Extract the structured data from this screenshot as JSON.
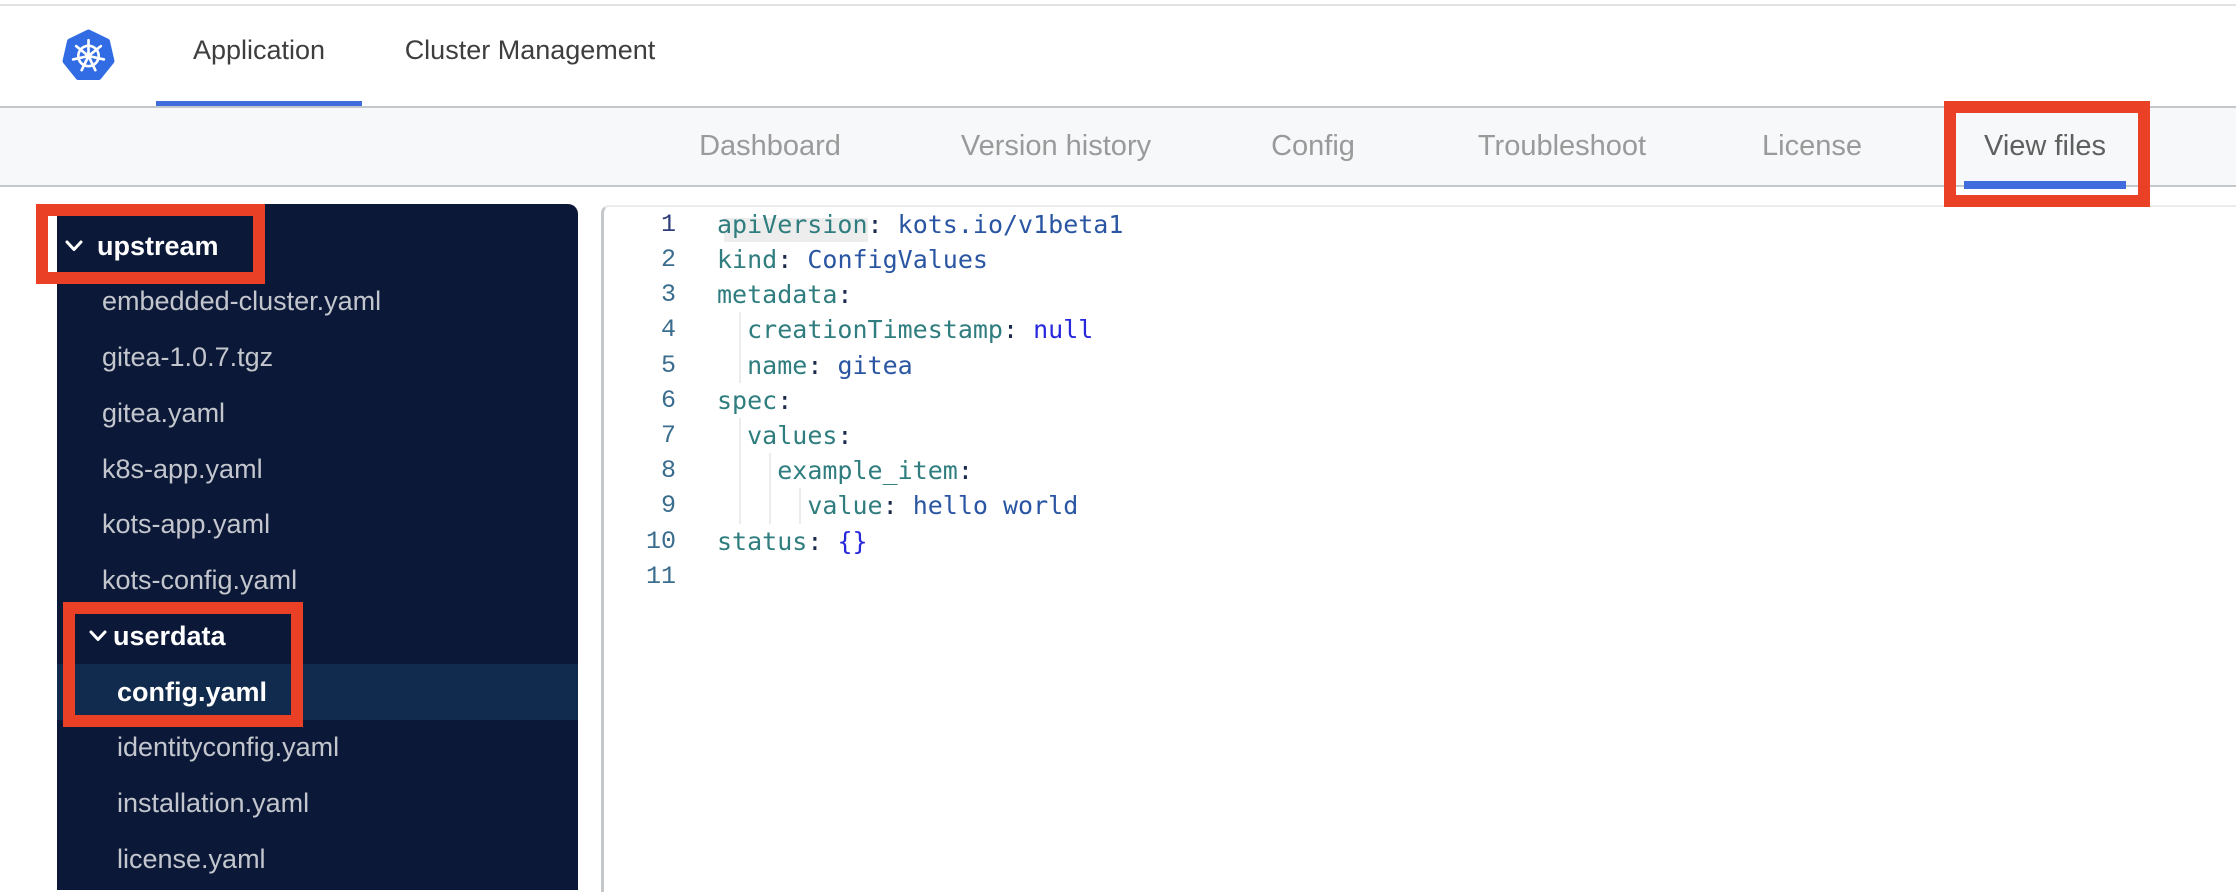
{
  "header": {
    "logo": "kubernetes-logo",
    "tabs": [
      {
        "label": "Application",
        "active": true
      },
      {
        "label": "Cluster Management",
        "active": false
      }
    ]
  },
  "subnav": {
    "items": [
      {
        "label": "Dashboard",
        "active": false
      },
      {
        "label": "Version history",
        "active": false
      },
      {
        "label": "Config",
        "active": false
      },
      {
        "label": "Troubleshoot",
        "active": false
      },
      {
        "label": "License",
        "active": false
      },
      {
        "label": "View files",
        "active": true
      }
    ]
  },
  "file_tree": {
    "items": [
      {
        "label": "upstream",
        "type": "folder",
        "level": 0,
        "expanded": true,
        "selected": false
      },
      {
        "label": "embedded-cluster.yaml",
        "type": "file",
        "level": 1,
        "selected": false
      },
      {
        "label": "gitea-1.0.7.tgz",
        "type": "file",
        "level": 1,
        "selected": false
      },
      {
        "label": "gitea.yaml",
        "type": "file",
        "level": 1,
        "selected": false
      },
      {
        "label": "k8s-app.yaml",
        "type": "file",
        "level": 1,
        "selected": false
      },
      {
        "label": "kots-app.yaml",
        "type": "file",
        "level": 1,
        "selected": false
      },
      {
        "label": "kots-config.yaml",
        "type": "file",
        "level": 1,
        "selected": false
      },
      {
        "label": "userdata",
        "type": "folder",
        "level": 1,
        "expanded": true,
        "selected": false
      },
      {
        "label": "config.yaml",
        "type": "file",
        "level": 2,
        "selected": true
      },
      {
        "label": "identityconfig.yaml",
        "type": "file",
        "level": 2,
        "selected": false
      },
      {
        "label": "installation.yaml",
        "type": "file",
        "level": 2,
        "selected": false
      },
      {
        "label": "license.yaml",
        "type": "file",
        "level": 2,
        "selected": false
      }
    ]
  },
  "editor": {
    "lines": [
      {
        "num": "1",
        "segments": [
          {
            "t": "apiVersion",
            "c": "key",
            "hl": true
          },
          {
            "t": ":",
            "c": "colon"
          },
          {
            "t": " ",
            "c": "plain"
          },
          {
            "t": "kots.io/v1beta1",
            "c": "val"
          }
        ]
      },
      {
        "num": "2",
        "segments": [
          {
            "t": "kind",
            "c": "key"
          },
          {
            "t": ":",
            "c": "colon"
          },
          {
            "t": " ",
            "c": "plain"
          },
          {
            "t": "ConfigValues",
            "c": "val"
          }
        ]
      },
      {
        "num": "3",
        "segments": [
          {
            "t": "metadata",
            "c": "key"
          },
          {
            "t": ":",
            "c": "colon"
          }
        ]
      },
      {
        "num": "4",
        "segments": [
          {
            "t": "  ",
            "c": "plain"
          },
          {
            "t": "creationTimestamp",
            "c": "key"
          },
          {
            "t": ":",
            "c": "colon"
          },
          {
            "t": " ",
            "c": "plain"
          },
          {
            "t": "null",
            "c": "const"
          }
        ]
      },
      {
        "num": "5",
        "segments": [
          {
            "t": "  ",
            "c": "plain"
          },
          {
            "t": "name",
            "c": "key"
          },
          {
            "t": ":",
            "c": "colon"
          },
          {
            "t": " ",
            "c": "plain"
          },
          {
            "t": "gitea",
            "c": "val"
          }
        ]
      },
      {
        "num": "6",
        "segments": [
          {
            "t": "spec",
            "c": "key"
          },
          {
            "t": ":",
            "c": "colon"
          }
        ]
      },
      {
        "num": "7",
        "segments": [
          {
            "t": "  ",
            "c": "plain"
          },
          {
            "t": "values",
            "c": "key"
          },
          {
            "t": ":",
            "c": "colon"
          }
        ]
      },
      {
        "num": "8",
        "segments": [
          {
            "t": "    ",
            "c": "plain"
          },
          {
            "t": "example_item",
            "c": "key"
          },
          {
            "t": ":",
            "c": "colon"
          }
        ]
      },
      {
        "num": "9",
        "segments": [
          {
            "t": "      ",
            "c": "plain"
          },
          {
            "t": "value",
            "c": "key"
          },
          {
            "t": ":",
            "c": "colon"
          },
          {
            "t": " ",
            "c": "plain"
          },
          {
            "t": "hello world",
            "c": "val"
          }
        ]
      },
      {
        "num": "10",
        "segments": [
          {
            "t": "status",
            "c": "key"
          },
          {
            "t": ":",
            "c": "colon"
          },
          {
            "t": " ",
            "c": "plain"
          },
          {
            "t": "{}",
            "c": "const"
          }
        ]
      },
      {
        "num": "11",
        "segments": []
      }
    ]
  },
  "annotations": {
    "color": "#ea4025",
    "boxes": [
      "view-files-tab",
      "upstream-folder",
      "userdata-config"
    ]
  }
}
